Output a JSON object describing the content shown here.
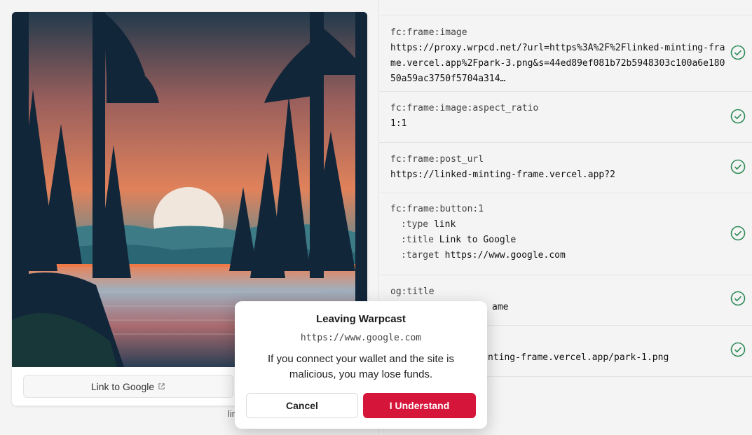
{
  "frame": {
    "button_label": "Link to Google",
    "below_text": "lin"
  },
  "meta": {
    "image": {
      "key": "fc:frame:image",
      "value": "https://proxy.wrpcd.net/?url=https%3A%2F%2Flinked-minting-frame.vercel.app%2Fpark-3.png&s=44ed89ef081b72b5948303c100a6e18050a59ac3750f5704a314…"
    },
    "aspect": {
      "key": "fc:frame:image:aspect_ratio",
      "value": "1:1"
    },
    "post_url": {
      "key": "fc:frame:post_url",
      "value": "https://linked-minting-frame.vercel.app?2"
    },
    "button1": {
      "key": "fc:frame:button:1",
      "type_key": ":type",
      "type_val": "link",
      "title_key": ":title",
      "title_val": "Link to Google",
      "target_key": ":target",
      "target_val": "https://www.google.com"
    },
    "og_title": {
      "key": "og:title",
      "value_visible": "ame"
    },
    "og_image": {
      "value_visible": "nting-frame.vercel.app/park-1.png"
    }
  },
  "dialog": {
    "title": "Leaving Warpcast",
    "url": "https://www.google.com",
    "message": "If you connect your wallet and the site is malicious, you may lose funds.",
    "cancel_label": "Cancel",
    "confirm_label": "I Understand"
  },
  "colors": {
    "check": "#2e8b57",
    "confirm": "#d6153a"
  }
}
